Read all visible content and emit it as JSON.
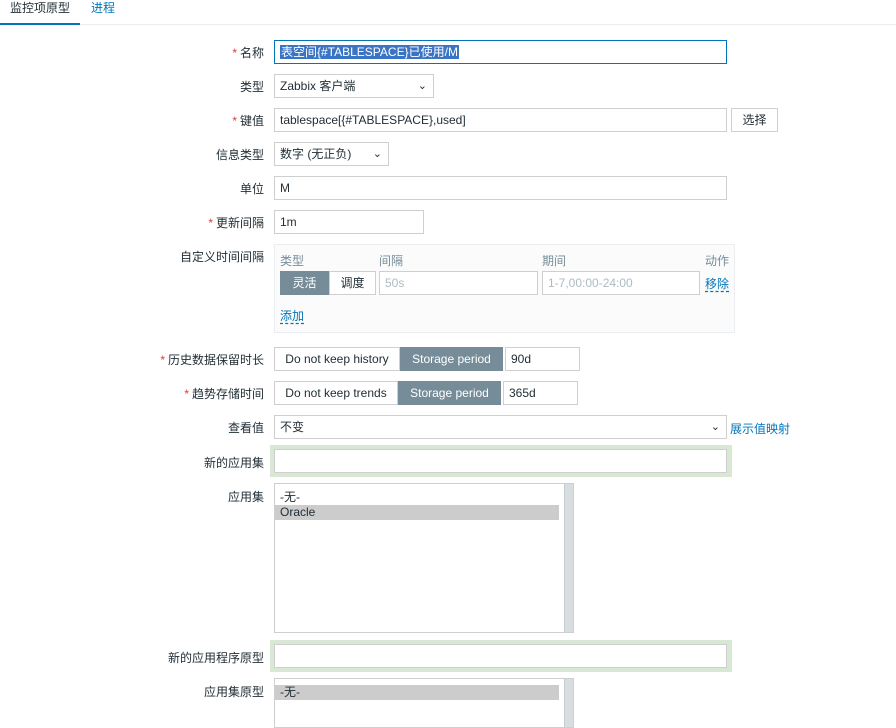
{
  "tabs": [
    {
      "label": "监控项原型"
    },
    {
      "label": "进程"
    }
  ],
  "form": {
    "name": {
      "label": "名称",
      "required_mark": "*",
      "value": "表空间{#TABLESPACE}已使用/M"
    },
    "type": {
      "label": "类型",
      "value": "Zabbix 客户端"
    },
    "key": {
      "label": "键值",
      "required_mark": "*",
      "value": "tablespace[{#TABLESPACE},used]",
      "select_label": "选择"
    },
    "info_type": {
      "label": "信息类型",
      "value": "数字 (无正负)"
    },
    "units": {
      "label": "单位",
      "value": "M"
    },
    "update_interval": {
      "label": "更新间隔",
      "required_mark": "*",
      "value": "1m"
    },
    "custom_intervals": {
      "label": "自定义时间间隔",
      "headers": {
        "type": "类型",
        "interval": "间隔",
        "period": "期间",
        "action": "动作"
      },
      "row": {
        "flexible_label": "灵活",
        "scheduling_label": "调度",
        "interval_placeholder": "50s",
        "period_placeholder": "1-7,00:00-24:00",
        "remove_label": "移除"
      },
      "add_label": "添加"
    },
    "history": {
      "label": "历史数据保留时长",
      "required_mark": "*",
      "option_off": "Do not keep history",
      "option_on": "Storage period",
      "value": "90d"
    },
    "trends": {
      "label": "趋势存储时间",
      "required_mark": "*",
      "option_off": "Do not keep trends",
      "option_on": "Storage period",
      "value": "365d"
    },
    "valuemap": {
      "label": "查看值",
      "value": "不变",
      "link": "展示值映射"
    },
    "new_application": {
      "label": "新的应用集",
      "value": ""
    },
    "applications": {
      "label": "应用集",
      "items": [
        "-无-",
        "Oracle"
      ],
      "selected_index": 1
    },
    "new_app_prototype": {
      "label": "新的应用程序原型",
      "value": ""
    },
    "app_prototypes": {
      "label": "应用集原型",
      "items": [
        "-无-"
      ],
      "selected_index": 0
    }
  }
}
